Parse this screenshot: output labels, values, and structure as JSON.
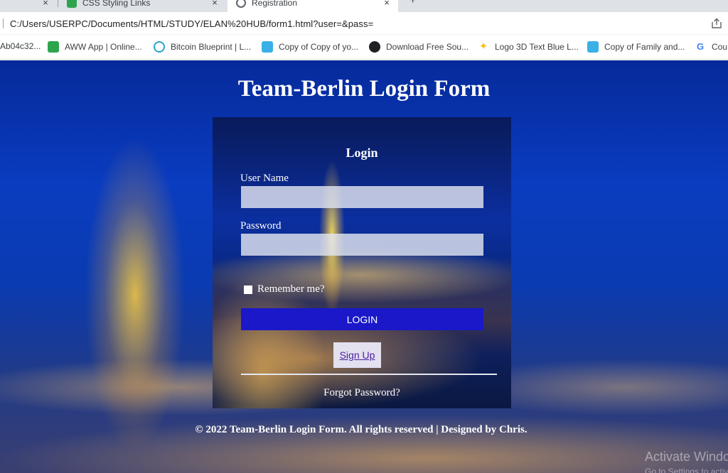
{
  "browser": {
    "tabs": [
      {
        "title": "",
        "close": "×"
      },
      {
        "title": "CSS Styling Links",
        "close": "×"
      },
      {
        "title": "Registration",
        "close": "×"
      }
    ],
    "new_tab": "+",
    "url": "C:/Users/USERPC/Documents/HTML/STUDY/ELAN%20HUB/form1.html?user=&pass=",
    "bookmarks": [
      {
        "label": "Ab04c32...",
        "icon": "none",
        "color": ""
      },
      {
        "label": "AWW App | Online...",
        "icon": "aww-icon",
        "color": "#2ea44f"
      },
      {
        "label": "Bitcoin Blueprint | L...",
        "icon": "swirl-icon",
        "color": "#29a3c9"
      },
      {
        "label": "Copy of Copy of yo...",
        "icon": "canva-icon",
        "color": "#3ab0e6"
      },
      {
        "label": "Download Free Sou...",
        "icon": "dark-circle-icon",
        "color": "#202124"
      },
      {
        "label": "Logo 3D Text Blue L...",
        "icon": "sparkle-icon",
        "color": "#f5c518"
      },
      {
        "label": "Copy of Family and...",
        "icon": "canva-icon",
        "color": "#3ab0e6"
      },
      {
        "label": "Cou",
        "icon": "google-icon",
        "color": "#4285f4"
      }
    ]
  },
  "page": {
    "title": "Team-Berlin Login Form",
    "form": {
      "heading": "Login",
      "username_label": "User Name",
      "username_value": "",
      "password_label": "Password",
      "password_value": "",
      "remember_label": "Remember me?",
      "login_button": "LOGIN",
      "signup_button": "Sign Up",
      "forgot_link": "Forgot Password?"
    },
    "footer": "© 2022 Team-Berlin Login Form. All rights reserved | Designed by Chris."
  },
  "watermark": {
    "title": "Activate Windows",
    "subtitle": "Go to Settings to activate Windows."
  },
  "colors": {
    "login_button": "#1a18c8",
    "signup_text": "#4b1f9e",
    "page_background": "#0a3cc0"
  }
}
